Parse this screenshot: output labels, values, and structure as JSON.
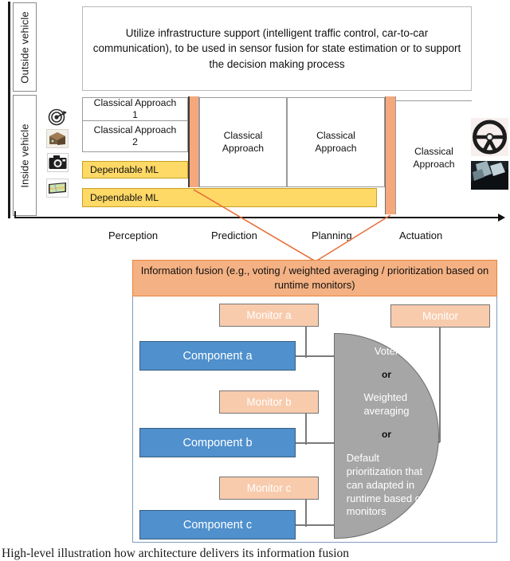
{
  "side_labels": {
    "outside": "Outside vehicle",
    "inside": "Inside vehicle"
  },
  "infrastructure": {
    "text": "Utilize infrastructure support (intelligent traffic control, car-to-car communication), to be used in sensor fusion for state estimation or to support the decision making process"
  },
  "sensors": [
    {
      "name": "radar-icon",
      "label": "radar"
    },
    {
      "name": "lidar-icon",
      "label": "lidar"
    },
    {
      "name": "camera-icon",
      "label": "camera"
    },
    {
      "name": "map-display-icon",
      "label": "map display"
    }
  ],
  "pipeline": {
    "perception": [
      {
        "line1": "Classical Approach",
        "line2": "1"
      },
      {
        "line1": "Classical Approach",
        "line2": "2"
      }
    ],
    "dependable_ml_perception": "Dependable ML",
    "dependable_ml_wide": "Dependable ML",
    "prediction": "Classical\nApproach",
    "prediction_l1": "Classical",
    "prediction_l2": "Approach",
    "planning_l1": "Classical",
    "planning_l2": "Approach",
    "actuation_l1": "Classical",
    "actuation_l2": "Approach"
  },
  "stages": [
    "Perception",
    "Prediction",
    "Planning",
    "Actuation"
  ],
  "actuators": [
    {
      "name": "steering-wheel-image",
      "label": "steering wheel"
    },
    {
      "name": "pedals-image",
      "label": "pedals"
    }
  ],
  "fusion_panel": {
    "header": "Information fusion (e.g., voting / weighted averaging / prioritization based on runtime monitors)",
    "monitors": [
      {
        "label": "Monitor a"
      },
      {
        "label": "Monitor b"
      },
      {
        "label": "Monitor c"
      },
      {
        "label": "Monitor"
      }
    ],
    "components": [
      {
        "label": "Component a"
      },
      {
        "label": "Component b"
      },
      {
        "label": "Component c"
      }
    ],
    "voter": {
      "option1": "Voter",
      "sep1": "or",
      "option2_l1": "Weighted",
      "option2_l2": "averaging",
      "sep2": "or",
      "option3_l1": "Default",
      "option3_l2": "prioritization that",
      "option3_l3": "can adapted in",
      "option3_l4": "runtime based on",
      "option3_l5": "monitors"
    }
  },
  "caption": "High-level illustration how architecture delivers its information fusion",
  "colors": {
    "component_blue": "#4F90CD",
    "monitor_salmon": "#F8CBAD",
    "header_orange": "#F4B183",
    "ml_yellow": "#FFD966",
    "voter_gray": "#A6A6A6",
    "leader_orange": "#E8703A"
  }
}
